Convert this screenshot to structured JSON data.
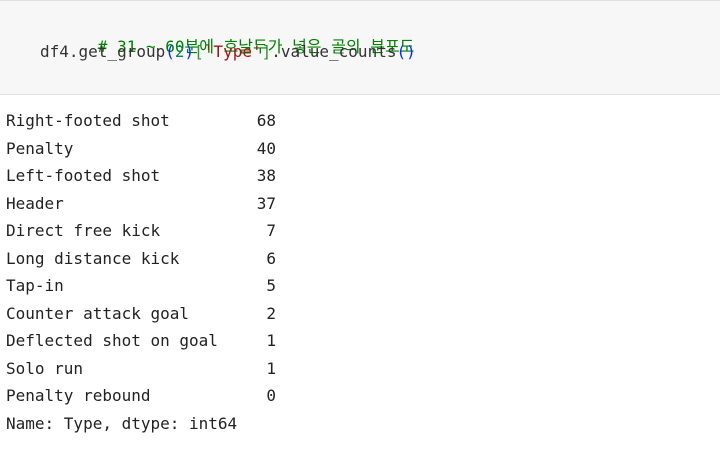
{
  "cell": {
    "comment": "# 31 ~ 60분에 호날두가 넣은 골의 분포도",
    "code": {
      "prefix": "df4.get_group",
      "open_paren": "(",
      "arg": "2",
      "close_paren": ")",
      "open_bracket": "[",
      "key": "'Type'",
      "close_bracket": "]",
      "method": ".value_counts",
      "call": "()"
    }
  },
  "output": {
    "rows": [
      {
        "label": "Right-footed shot",
        "value": "68"
      },
      {
        "label": "Penalty",
        "value": "40"
      },
      {
        "label": "Left-footed shot",
        "value": "38"
      },
      {
        "label": "Header",
        "value": "37"
      },
      {
        "label": "Direct free kick",
        "value": "7"
      },
      {
        "label": "Long distance kick",
        "value": "6"
      },
      {
        "label": "Tap-in",
        "value": "5"
      },
      {
        "label": "Counter attack goal",
        "value": "2"
      },
      {
        "label": "Deflected shot on goal",
        "value": "1"
      },
      {
        "label": "Solo run",
        "value": "1"
      },
      {
        "label": "Penalty rebound",
        "value": "0"
      }
    ],
    "footer": "Name: Type, dtype: int64"
  }
}
